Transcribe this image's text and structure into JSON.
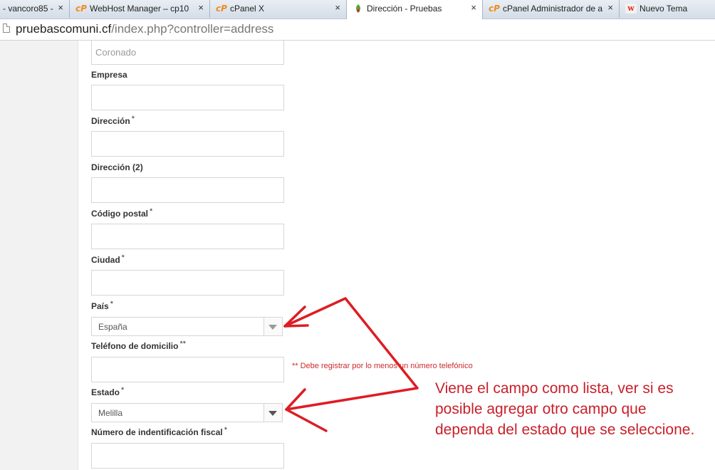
{
  "browser": {
    "tabs": [
      {
        "label": "- vancoro85 -",
        "icon": "generic"
      },
      {
        "label": "WebHost Manager – cp10",
        "icon": "cp"
      },
      {
        "label": "cPanel X",
        "icon": "cp"
      },
      {
        "label": "Dirección - Pruebas",
        "icon": "leaf",
        "active": true
      },
      {
        "label": "cPanel Administrador de a",
        "icon": "cp"
      },
      {
        "label": "Nuevo Tema",
        "icon": "w"
      }
    ],
    "close_glyph": "×",
    "url_host": "pruebascomuni.cf",
    "url_path": "/index.php?controller=address"
  },
  "form": {
    "top_field_value": "Coronado",
    "company_label": "Empresa",
    "address_label": "Dirección",
    "address2_label": "Dirección (2)",
    "postcode_label": "Código postal",
    "city_label": "Ciudad",
    "country_label": "País",
    "country_value": "España",
    "phone_label": "Teléfono de domicilio",
    "phone_req": "**",
    "phone_hint": "** Debe registrar por lo menos un número telefónico",
    "state_label": "Estado",
    "state_value": "Melilla",
    "taxid_label": "Número de indentificación fiscal",
    "req": "*"
  },
  "annotation": {
    "text": "Viene el campo como lista, ver si es posible agregar otro campo que dependa del estado que se seleccione.",
    "color": "#c8202a"
  }
}
